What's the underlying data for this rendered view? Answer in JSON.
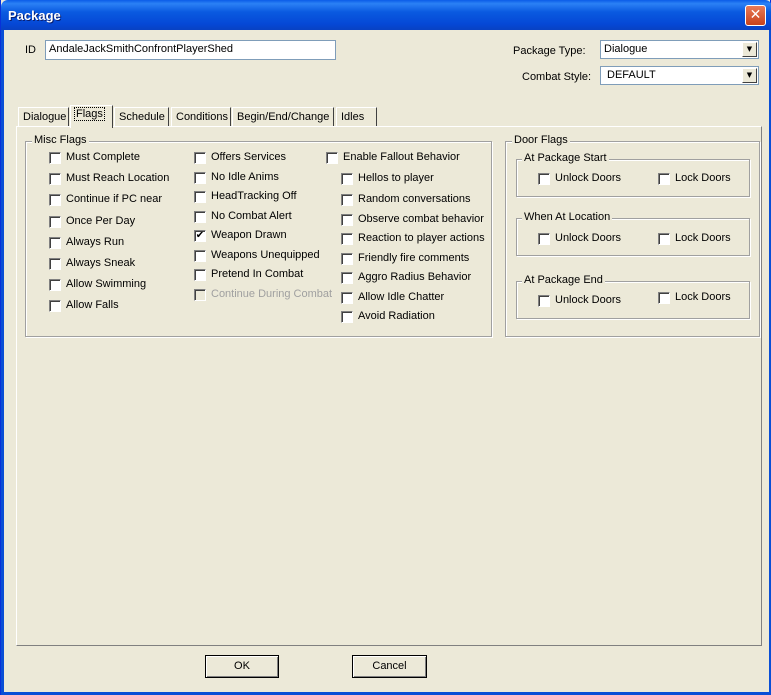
{
  "window": {
    "title": "Package",
    "close_glyph": "✕"
  },
  "fields": {
    "id_label": "ID",
    "id_value": "AndaleJackSmithConfrontPlayerShed",
    "package_type_label": "Package Type:",
    "package_type_value": "Dialogue",
    "combat_style_label": "Combat Style:",
    "combat_style_value": "DEFAULT"
  },
  "tabs": [
    {
      "label": "Dialogue",
      "active": false
    },
    {
      "label": "Flags",
      "active": true
    },
    {
      "label": "Schedule",
      "active": false
    },
    {
      "label": "Conditions",
      "active": false
    },
    {
      "label": "Begin/End/Change",
      "active": false
    },
    {
      "label": "Idles",
      "active": false
    }
  ],
  "misc_flags": {
    "title": "Misc Flags",
    "col1": [
      {
        "label": "Must Complete",
        "checked": false
      },
      {
        "label": "Must Reach Location",
        "checked": false
      },
      {
        "label": "Continue if PC near",
        "checked": false
      },
      {
        "label": "Once Per Day",
        "checked": false
      },
      {
        "label": "Always Run",
        "checked": false
      },
      {
        "label": "Always Sneak",
        "checked": false
      },
      {
        "label": "Allow Swimming",
        "checked": false
      },
      {
        "label": "Allow Falls",
        "checked": false
      }
    ],
    "col2": [
      {
        "label": "Offers Services",
        "checked": false
      },
      {
        "label": "No Idle Anims",
        "checked": false
      },
      {
        "label": "HeadTracking Off",
        "checked": false
      },
      {
        "label": "No Combat Alert",
        "checked": false
      },
      {
        "label": "Weapon Drawn",
        "checked": true
      },
      {
        "label": "Weapons Unequipped",
        "checked": false
      },
      {
        "label": "Pretend In Combat",
        "checked": false
      },
      {
        "label": "Continue During Combat",
        "checked": false,
        "disabled": true
      }
    ],
    "col3_top": {
      "label": "Enable Fallout Behavior",
      "checked": false
    },
    "col3": [
      {
        "label": "Hellos to player",
        "checked": false
      },
      {
        "label": "Random conversations",
        "checked": false
      },
      {
        "label": "Observe combat behavior",
        "checked": false
      },
      {
        "label": "Reaction to player actions",
        "checked": false
      },
      {
        "label": "Friendly fire comments",
        "checked": false
      },
      {
        "label": "Aggro Radius Behavior",
        "checked": false
      },
      {
        "label": "Allow Idle Chatter",
        "checked": false
      },
      {
        "label": "Avoid Radiation",
        "checked": false
      }
    ]
  },
  "door_flags": {
    "title": "Door Flags",
    "groups": [
      {
        "title": "At Package Start",
        "unlock": "Unlock Doors",
        "lock": "Lock Doors"
      },
      {
        "title": "When At Location",
        "unlock": "Unlock Doors",
        "lock": "Lock Doors"
      },
      {
        "title": "At Package End",
        "unlock": "Unlock Doors",
        "lock": "Lock Doors"
      }
    ]
  },
  "buttons": {
    "ok": "OK",
    "cancel": "Cancel"
  }
}
